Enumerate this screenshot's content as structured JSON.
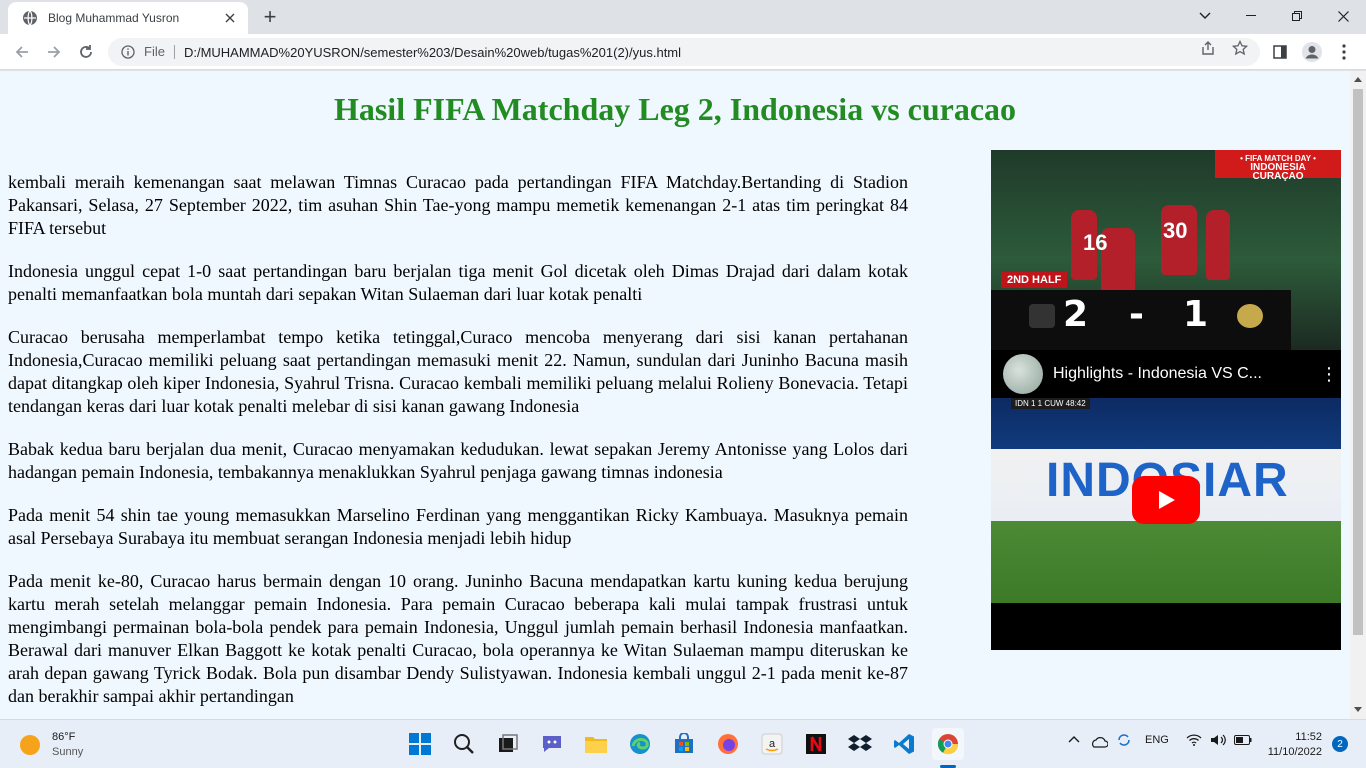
{
  "browser": {
    "tab_title": "Blog Muhammad Yusron",
    "new_tab_symbol": "+",
    "file_label": "File",
    "url": "D:/MUHAMMAD%20YUSRON/semester%203/Desain%20web/tugas%201(2)/yus.html"
  },
  "page": {
    "title": "Hasil FIFA Matchday Leg 2, Indonesia vs curacao",
    "paragraphs": [
      "kembali meraih kemenangan saat melawan Timnas Curacao pada pertandingan FIFA Matchday.Bertanding di Stadion Pakansari, Selasa, 27 September 2022, tim asuhan Shin Tae-yong mampu memetik kemenangan 2-1 atas tim peringkat 84 FIFA tersebut",
      "Indonesia unggul cepat 1-0 saat pertandingan baru berjalan tiga menit Gol dicetak oleh Dimas Drajad dari dalam kotak penalti memanfaatkan bola muntah dari sepakan Witan Sulaeman dari luar kotak penalti",
      "Curacao berusaha memperlambat tempo ketika tetinggal,Curaco mencoba menyerang dari sisi kanan pertahanan Indonesia,Curacao memiliki peluang saat pertandingan memasuki menit 22. Namun, sundulan dari Juninho Bacuna masih dapat ditangkap oleh kiper Indonesia, Syahrul Trisna. Curacao kembali memiliki peluang melalui Rolieny Bonevacia. Tetapi tendangan keras dari luar kotak penalti melebar di sisi kanan gawang Indonesia",
      "Babak kedua baru berjalan dua menit, Curacao menyamakan kedudukan. lewat sepakan Jeremy Antonisse yang Lolos dari hadangan pemain Indonesia, tembakannya menaklukkan Syahrul penjaga gawang timnas indonesia",
      "Pada menit 54 shin tae young memasukkan Marselino Ferdinan yang menggantikan Ricky Kambuaya. Masuknya pemain asal Persebaya Surabaya itu membuat serangan Indonesia menjadi lebih hidup",
      "Pada menit ke-80, Curacao harus bermain dengan 10 orang. Juninho Bacuna mendapatkan kartu kuning kedua berujung kartu merah setelah melanggar pemain Indonesia. Para pemain Curacao beberapa kali mulai tampak frustrasi untuk mengimbangi permainan bola-bola pendek para pemain Indonesia, Unggul jumlah pemain berhasil Indonesia manfaatkan. Berawal dari manuver Elkan Baggott ke kotak penalti Curacao, bola operannya ke Witan Sulaeman mampu diteruskan ke arah depan gawang Tyrick Bodak. Bola pun disambar Dendy Sulistyawan. Indonesia kembali unggul 2-1 pada menit ke-87 dan berakhir sampai akhir pertandingan"
    ]
  },
  "video": {
    "title": "Highlights - Indonesia VS C...",
    "menu_symbol": "⋮",
    "promo_line1": "• FIFA MATCH DAY •",
    "promo_line2": "INDONESIA",
    "promo_line3": "CURAÇAO",
    "half_label": "2ND HALF",
    "score_home": "2",
    "score_separator": "-",
    "score_away": "1",
    "jersey_numbers": [
      "16",
      "30"
    ],
    "board_text": "INDOSIAR",
    "strip_text": "IDN 1 1 CUW 48:42"
  },
  "taskbar": {
    "temperature": "86°F",
    "condition": "Sunny",
    "language": "ENG",
    "time": "11:52",
    "date": "11/10/2022",
    "notifications": "2"
  },
  "colors": {
    "title_color": "#228b22",
    "page_bg": "#f0f8ff",
    "youtube_red": "#ff0000"
  }
}
